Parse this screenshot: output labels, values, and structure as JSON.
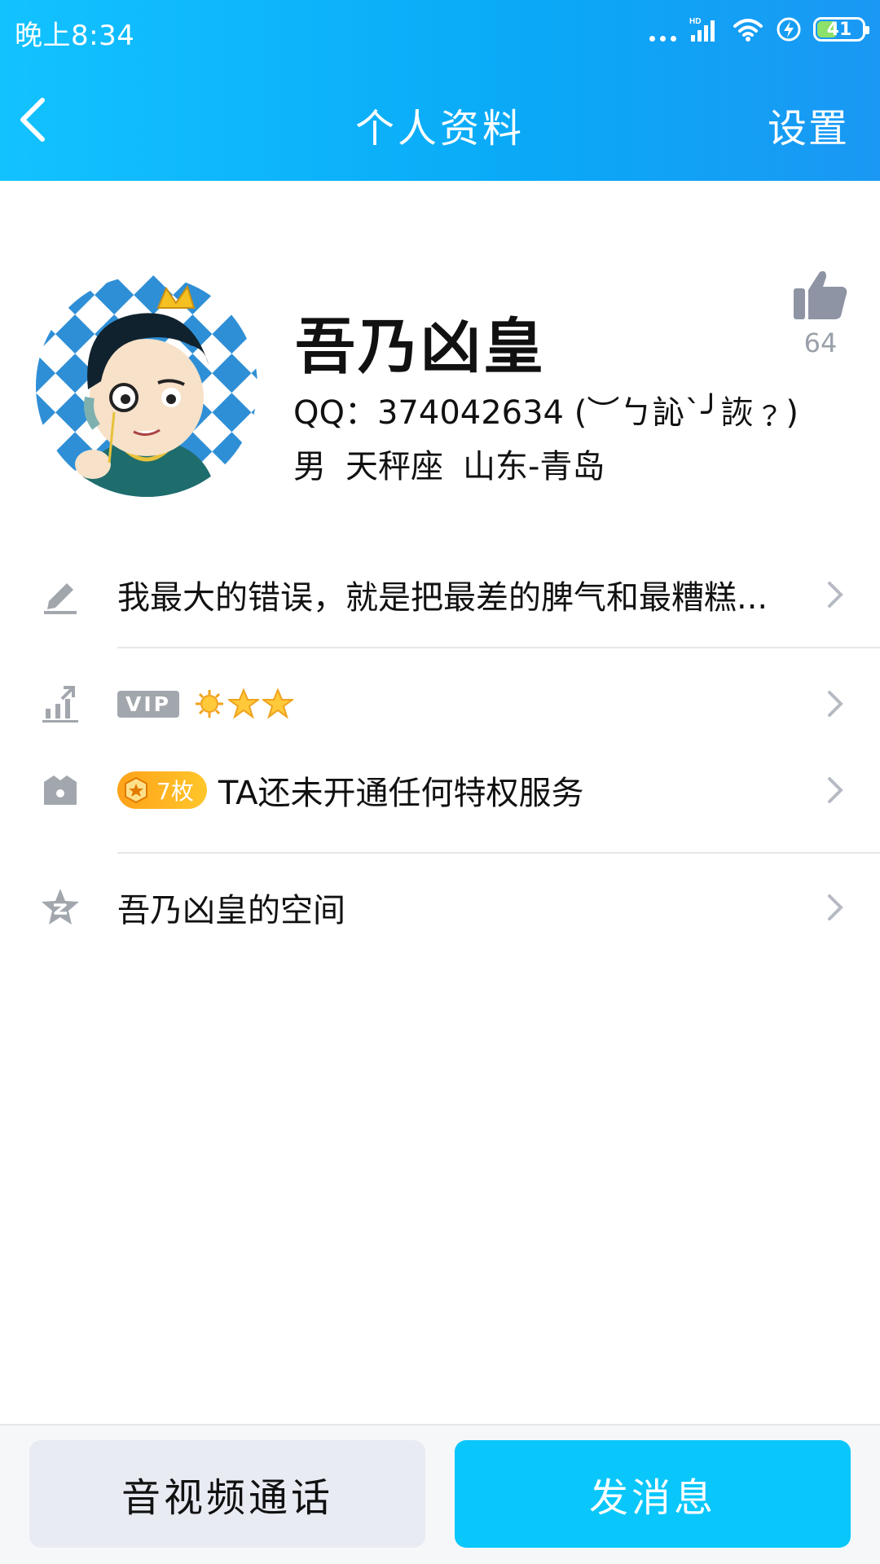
{
  "status_bar": {
    "time": "晚上8:34",
    "battery_level": "41",
    "network_label": "HD"
  },
  "nav": {
    "title": "个人资料",
    "settings_label": "设置"
  },
  "profile": {
    "name": "吾乃凶皇",
    "qq_line": "QQ：374042634 (︶ㄅ訫ˋ╯詼﹖)",
    "gender": "男",
    "zodiac": "天秤座",
    "location": "山东-青岛",
    "likes": "64"
  },
  "rows": {
    "signature": "我最大的错误，就是把最差的脾气和最糟糕...",
    "vip_badge": "VIP",
    "medal_count": "7枚",
    "privilege_text": "TA还未开通任何特权服务",
    "space_text": "吾乃凶皇的空间"
  },
  "bottom": {
    "call_label": "音视频通话",
    "message_label": "发消息"
  },
  "colors": {
    "header_start": "#12c2ff",
    "header_end": "#1a98f3",
    "primary_button": "#09c7fb",
    "icon_gray": "#a2a6ad"
  }
}
